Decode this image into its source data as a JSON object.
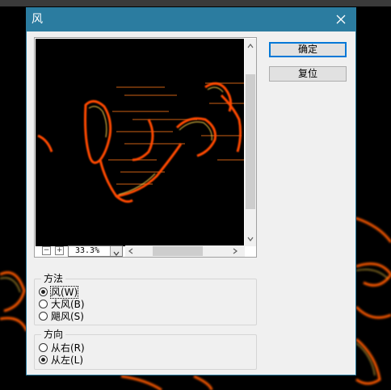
{
  "dialog": {
    "title": "风",
    "ok_label": "确定",
    "reset_label": "复位"
  },
  "zoom": {
    "minus": "−",
    "plus": "+",
    "value": "33.3%"
  },
  "method_group": {
    "label": "方法",
    "options": [
      {
        "label": "风(W)",
        "selected": true
      },
      {
        "label": "大风(B)",
        "selected": false
      },
      {
        "label": "飓风(S)",
        "selected": false
      }
    ]
  },
  "direction_group": {
    "label": "方向",
    "options": [
      {
        "label": "从右(R)",
        "selected": false
      },
      {
        "label": "从左(L)",
        "selected": true
      }
    ]
  },
  "colors": {
    "title_bar": "#2b7ca0",
    "fire_orange": "#ff6a00",
    "fire_yellow": "#ffd24a"
  }
}
